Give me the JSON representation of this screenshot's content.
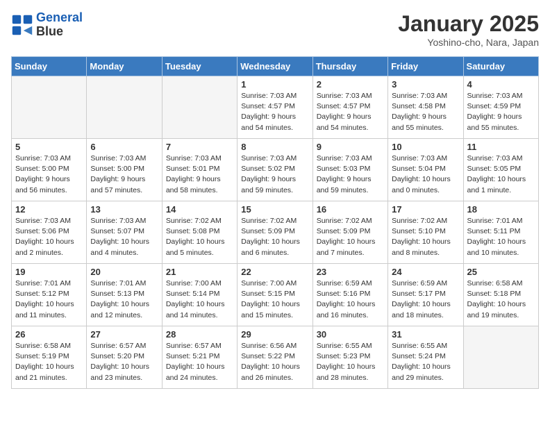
{
  "header": {
    "logo_line1": "General",
    "logo_line2": "Blue",
    "title": "January 2025",
    "location": "Yoshino-cho, Nara, Japan"
  },
  "days_of_week": [
    "Sunday",
    "Monday",
    "Tuesday",
    "Wednesday",
    "Thursday",
    "Friday",
    "Saturday"
  ],
  "weeks": [
    [
      {
        "day": "",
        "empty": true
      },
      {
        "day": "",
        "empty": true
      },
      {
        "day": "",
        "empty": true
      },
      {
        "day": "1",
        "sunrise": "7:03 AM",
        "sunset": "4:57 PM",
        "daylight": "9 hours and 54 minutes."
      },
      {
        "day": "2",
        "sunrise": "7:03 AM",
        "sunset": "4:57 PM",
        "daylight": "9 hours and 54 minutes."
      },
      {
        "day": "3",
        "sunrise": "7:03 AM",
        "sunset": "4:58 PM",
        "daylight": "9 hours and 55 minutes."
      },
      {
        "day": "4",
        "sunrise": "7:03 AM",
        "sunset": "4:59 PM",
        "daylight": "9 hours and 55 minutes."
      }
    ],
    [
      {
        "day": "5",
        "sunrise": "7:03 AM",
        "sunset": "5:00 PM",
        "daylight": "9 hours and 56 minutes."
      },
      {
        "day": "6",
        "sunrise": "7:03 AM",
        "sunset": "5:00 PM",
        "daylight": "9 hours and 57 minutes."
      },
      {
        "day": "7",
        "sunrise": "7:03 AM",
        "sunset": "5:01 PM",
        "daylight": "9 hours and 58 minutes."
      },
      {
        "day": "8",
        "sunrise": "7:03 AM",
        "sunset": "5:02 PM",
        "daylight": "9 hours and 59 minutes."
      },
      {
        "day": "9",
        "sunrise": "7:03 AM",
        "sunset": "5:03 PM",
        "daylight": "9 hours and 59 minutes."
      },
      {
        "day": "10",
        "sunrise": "7:03 AM",
        "sunset": "5:04 PM",
        "daylight": "10 hours and 0 minutes."
      },
      {
        "day": "11",
        "sunrise": "7:03 AM",
        "sunset": "5:05 PM",
        "daylight": "10 hours and 1 minute."
      }
    ],
    [
      {
        "day": "12",
        "sunrise": "7:03 AM",
        "sunset": "5:06 PM",
        "daylight": "10 hours and 2 minutes."
      },
      {
        "day": "13",
        "sunrise": "7:03 AM",
        "sunset": "5:07 PM",
        "daylight": "10 hours and 4 minutes."
      },
      {
        "day": "14",
        "sunrise": "7:02 AM",
        "sunset": "5:08 PM",
        "daylight": "10 hours and 5 minutes."
      },
      {
        "day": "15",
        "sunrise": "7:02 AM",
        "sunset": "5:09 PM",
        "daylight": "10 hours and 6 minutes."
      },
      {
        "day": "16",
        "sunrise": "7:02 AM",
        "sunset": "5:09 PM",
        "daylight": "10 hours and 7 minutes."
      },
      {
        "day": "17",
        "sunrise": "7:02 AM",
        "sunset": "5:10 PM",
        "daylight": "10 hours and 8 minutes."
      },
      {
        "day": "18",
        "sunrise": "7:01 AM",
        "sunset": "5:11 PM",
        "daylight": "10 hours and 10 minutes."
      }
    ],
    [
      {
        "day": "19",
        "sunrise": "7:01 AM",
        "sunset": "5:12 PM",
        "daylight": "10 hours and 11 minutes."
      },
      {
        "day": "20",
        "sunrise": "7:01 AM",
        "sunset": "5:13 PM",
        "daylight": "10 hours and 12 minutes."
      },
      {
        "day": "21",
        "sunrise": "7:00 AM",
        "sunset": "5:14 PM",
        "daylight": "10 hours and 14 minutes."
      },
      {
        "day": "22",
        "sunrise": "7:00 AM",
        "sunset": "5:15 PM",
        "daylight": "10 hours and 15 minutes."
      },
      {
        "day": "23",
        "sunrise": "6:59 AM",
        "sunset": "5:16 PM",
        "daylight": "10 hours and 16 minutes."
      },
      {
        "day": "24",
        "sunrise": "6:59 AM",
        "sunset": "5:17 PM",
        "daylight": "10 hours and 18 minutes."
      },
      {
        "day": "25",
        "sunrise": "6:58 AM",
        "sunset": "5:18 PM",
        "daylight": "10 hours and 19 minutes."
      }
    ],
    [
      {
        "day": "26",
        "sunrise": "6:58 AM",
        "sunset": "5:19 PM",
        "daylight": "10 hours and 21 minutes."
      },
      {
        "day": "27",
        "sunrise": "6:57 AM",
        "sunset": "5:20 PM",
        "daylight": "10 hours and 23 minutes."
      },
      {
        "day": "28",
        "sunrise": "6:57 AM",
        "sunset": "5:21 PM",
        "daylight": "10 hours and 24 minutes."
      },
      {
        "day": "29",
        "sunrise": "6:56 AM",
        "sunset": "5:22 PM",
        "daylight": "10 hours and 26 minutes."
      },
      {
        "day": "30",
        "sunrise": "6:55 AM",
        "sunset": "5:23 PM",
        "daylight": "10 hours and 28 minutes."
      },
      {
        "day": "31",
        "sunrise": "6:55 AM",
        "sunset": "5:24 PM",
        "daylight": "10 hours and 29 minutes."
      },
      {
        "day": "",
        "empty": true
      }
    ]
  ]
}
